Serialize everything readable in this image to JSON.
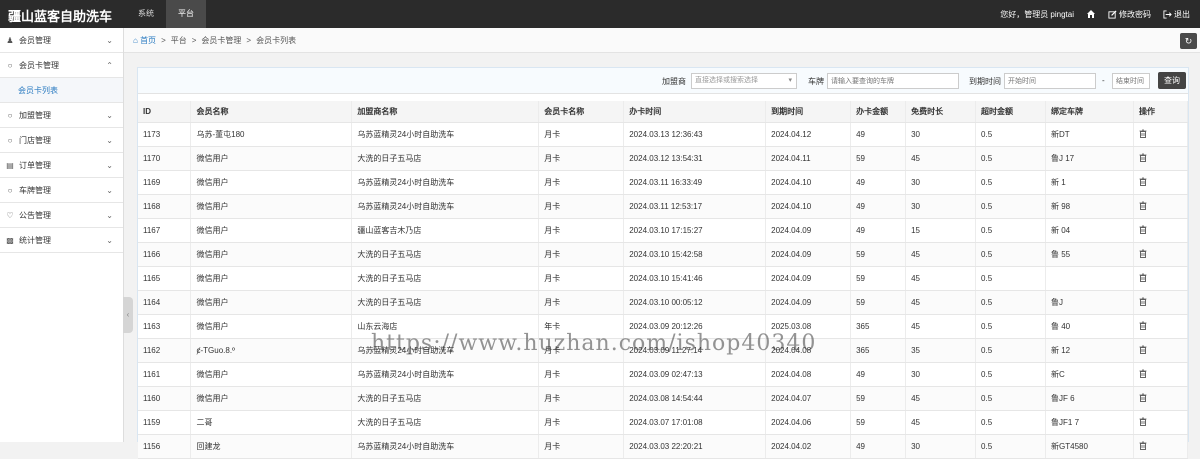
{
  "app": {
    "title": "疆山蓝客自助洗车"
  },
  "topnav": {
    "items": [
      {
        "label": "系统"
      },
      {
        "label": "平台"
      }
    ]
  },
  "topright": {
    "greeting": "您好，管理员 pingtai",
    "change_password": "修改密码",
    "logout": "退出"
  },
  "sidebar": {
    "items": [
      {
        "label": "会员管理",
        "icon": "user-icon"
      },
      {
        "label": "会员卡管理",
        "icon": "circle-icon",
        "expanded": true
      },
      {
        "label": "加盟管理",
        "icon": "circle-icon"
      },
      {
        "label": "门店管理",
        "icon": "circle-icon"
      },
      {
        "label": "订单管理",
        "icon": "list-icon"
      },
      {
        "label": "车牌管理",
        "icon": "circle-icon"
      },
      {
        "label": "公告管理",
        "icon": "bell-icon"
      },
      {
        "label": "统计管理",
        "icon": "chart-icon"
      }
    ],
    "sub_item": "会员卡列表"
  },
  "breadcrumb": {
    "home": "首页",
    "items": [
      "平台",
      "会员卡管理",
      "会员卡列表"
    ]
  },
  "filters": {
    "franchise_label": "加盟商",
    "franchise_placeholder": "直接选择或搜索选择",
    "plate_label": "车牌",
    "plate_placeholder": "请输入要查询的车牌",
    "expire_label": "到期时间",
    "start_placeholder": "开始时间",
    "sep": "-",
    "end_placeholder": "结束时间",
    "search_label": "查询"
  },
  "table": {
    "headers": [
      "ID",
      "会员名称",
      "加盟商名称",
      "会员卡名称",
      "办卡时间",
      "到期时间",
      "办卡金额",
      "免费时长",
      "超时金额",
      "绑定车牌",
      "操作"
    ],
    "rows": [
      [
        "1173",
        "乌苏-董屯180",
        "乌苏蓝精灵24小时自助洗车",
        "月卡",
        "2024.03.13 12:36:43",
        "2024.04.12",
        "49",
        "30",
        "0.5",
        "新DT"
      ],
      [
        "1170",
        "微信用户",
        "大洗的日子五马店",
        "月卡",
        "2024.03.12 13:54:31",
        "2024.04.11",
        "59",
        "45",
        "0.5",
        "鲁J    17"
      ],
      [
        "1169",
        "微信用户",
        "乌苏蓝精灵24小时自助洗车",
        "月卡",
        "2024.03.11 16:33:49",
        "2024.04.10",
        "49",
        "30",
        "0.5",
        "新    1"
      ],
      [
        "1168",
        "微信用户",
        "乌苏蓝精灵24小时自助洗车",
        "月卡",
        "2024.03.11 12:53:17",
        "2024.04.10",
        "49",
        "30",
        "0.5",
        "新    98"
      ],
      [
        "1167",
        "微信用户",
        "疆山蓝客吉木乃店",
        "月卡",
        "2024.03.10 17:15:27",
        "2024.04.09",
        "49",
        "15",
        "0.5",
        "新    04"
      ],
      [
        "1166",
        "微信用户",
        "大洗的日子五马店",
        "月卡",
        "2024.03.10 15:42:58",
        "2024.04.09",
        "59",
        "45",
        "0.5",
        "鲁    55"
      ],
      [
        "1165",
        "微信用户",
        "大洗的日子五马店",
        "月卡",
        "2024.03.10 15:41:46",
        "2024.04.09",
        "59",
        "45",
        "0.5",
        ""
      ],
      [
        "1164",
        "微信用户",
        "大洗的日子五马店",
        "月卡",
        "2024.03.10 00:05:12",
        "2024.04.09",
        "59",
        "45",
        "0.5",
        "鲁J"
      ],
      [
        "1163",
        "微信用户",
        "山东云海店",
        "年卡",
        "2024.03.09 20:12:26",
        "2025.03.08",
        "365",
        "45",
        "0.5",
        "鲁    40"
      ],
      [
        "1162",
        "ȼ-TGuo.8.º",
        "乌苏蓝精灵24小时自助洗车",
        "月卡",
        "2024.03.09 11:27:14",
        "2024.04.08",
        "365",
        "35",
        "0.5",
        "新    12"
      ],
      [
        "1161",
        "微信用户",
        "乌苏蓝精灵24小时自助洗车",
        "月卡",
        "2024.03.09 02:47:13",
        "2024.04.08",
        "49",
        "30",
        "0.5",
        "新C"
      ],
      [
        "1160",
        "微信用户",
        "大洗的日子五马店",
        "月卡",
        "2024.03.08 14:54:44",
        "2024.04.07",
        "59",
        "45",
        "0.5",
        "鲁JF    6"
      ],
      [
        "1159",
        "二哥",
        "大洗的日子五马店",
        "月卡",
        "2024.03.07 17:01:08",
        "2024.04.06",
        "59",
        "45",
        "0.5",
        "鲁JF1    7"
      ],
      [
        "1156",
        "回建龙",
        "乌苏蓝精灵24小时自助洗车",
        "月卡",
        "2024.03.03 22:20:21",
        "2024.04.02",
        "49",
        "30",
        "0.5",
        "新GT4580"
      ]
    ]
  },
  "watermark": "https://www.huzhan.com/ishop40340"
}
